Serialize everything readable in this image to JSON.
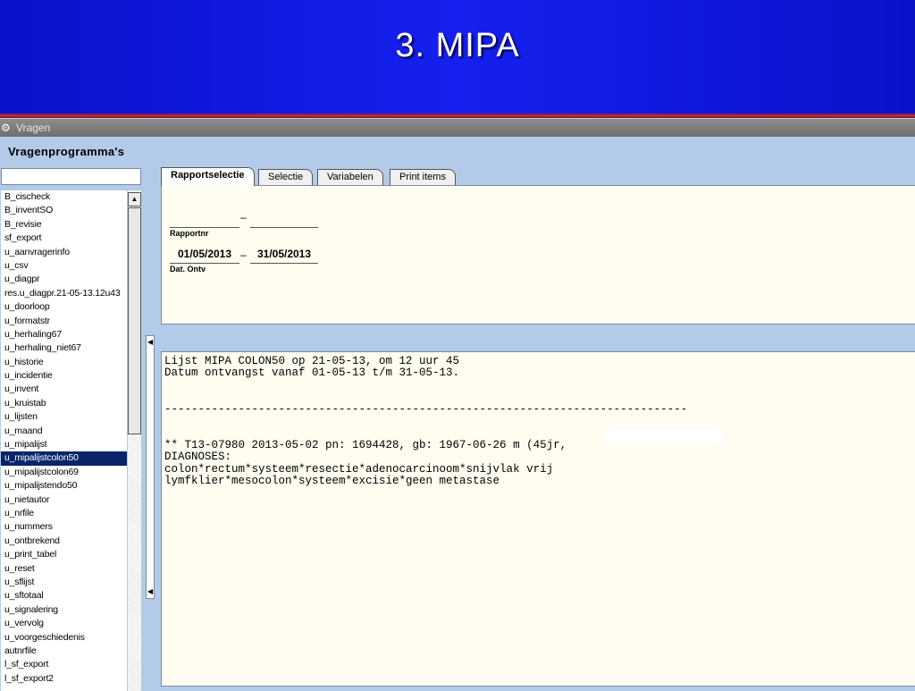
{
  "slide": {
    "title": "3. MIPA"
  },
  "window": {
    "title": "Vragen",
    "icon": "app-icon"
  },
  "sidebar": {
    "section_label": "Vragenprogramma's",
    "filter_value": "",
    "items": [
      "B_cischeck",
      "B_inventSO",
      "B_revisie",
      "sf_export",
      "u_aanvragerinfo",
      "u_csv",
      "u_diagpr",
      "res.u_diagpr.21-05-13.12u43",
      "u_doorloop",
      "u_formatstr",
      "u_herhaling67",
      "u_herhaling_niet67",
      "u_historie",
      "u_incidentie",
      "u_invent",
      "u_kruistab",
      "u_lijsten",
      "u_maand",
      "u_mipalijst",
      "u_mipalijstcolon50",
      "u_mipalijstcolon69",
      "u_mipalijstendo50",
      "u_nietautor",
      "u_nrfile",
      "u_nummers",
      "u_ontbrekend",
      "u_print_tabel",
      "u_reset",
      "u_sflijst",
      "u_sftotaal",
      "u_signalering",
      "u_vervolg",
      "u_voorgeschiedenis",
      "autnrfile",
      "l_sf_export",
      "l_sf_export2"
    ],
    "selected": "u_mipalijstcolon50"
  },
  "tabs": [
    {
      "label": "Rapportselectie",
      "active": true
    },
    {
      "label": "Selectie",
      "active": false
    },
    {
      "label": "Variabelen",
      "active": false
    },
    {
      "label": "Print items",
      "active": false
    }
  ],
  "form": {
    "rapportnr": {
      "from": "",
      "to": "",
      "dash": "–",
      "caption": "Rapportnr"
    },
    "dat_ontv": {
      "from": "01/05/2013",
      "to": "31/05/2013",
      "dash": "–",
      "caption": "Dat. Ontv"
    }
  },
  "output": {
    "lines": [
      "Lijst MIPA COLON50 op 21-05-13, om 12 uur 45",
      "Datum ontvangst vanaf 01-05-13 t/m 31-05-13.",
      "",
      "",
      "------------------------------------------------------------------------------",
      "",
      "",
      "** T13-07980 2013-05-02 pn: 1694428, gb: 1967-06-26 m (45jr,",
      "DIAGNOSES:",
      "colon*rectum*systeem*resectie*adenocarcinoom*snijvlak vrij",
      "lymfklier*mesocolon*systeem*excisie*geen metastase"
    ]
  },
  "colors": {
    "header_blue": "#1520f0",
    "selection": "#0a246a",
    "panel_bg": "#fffdf0",
    "window_bg": "#b3cbe9"
  }
}
